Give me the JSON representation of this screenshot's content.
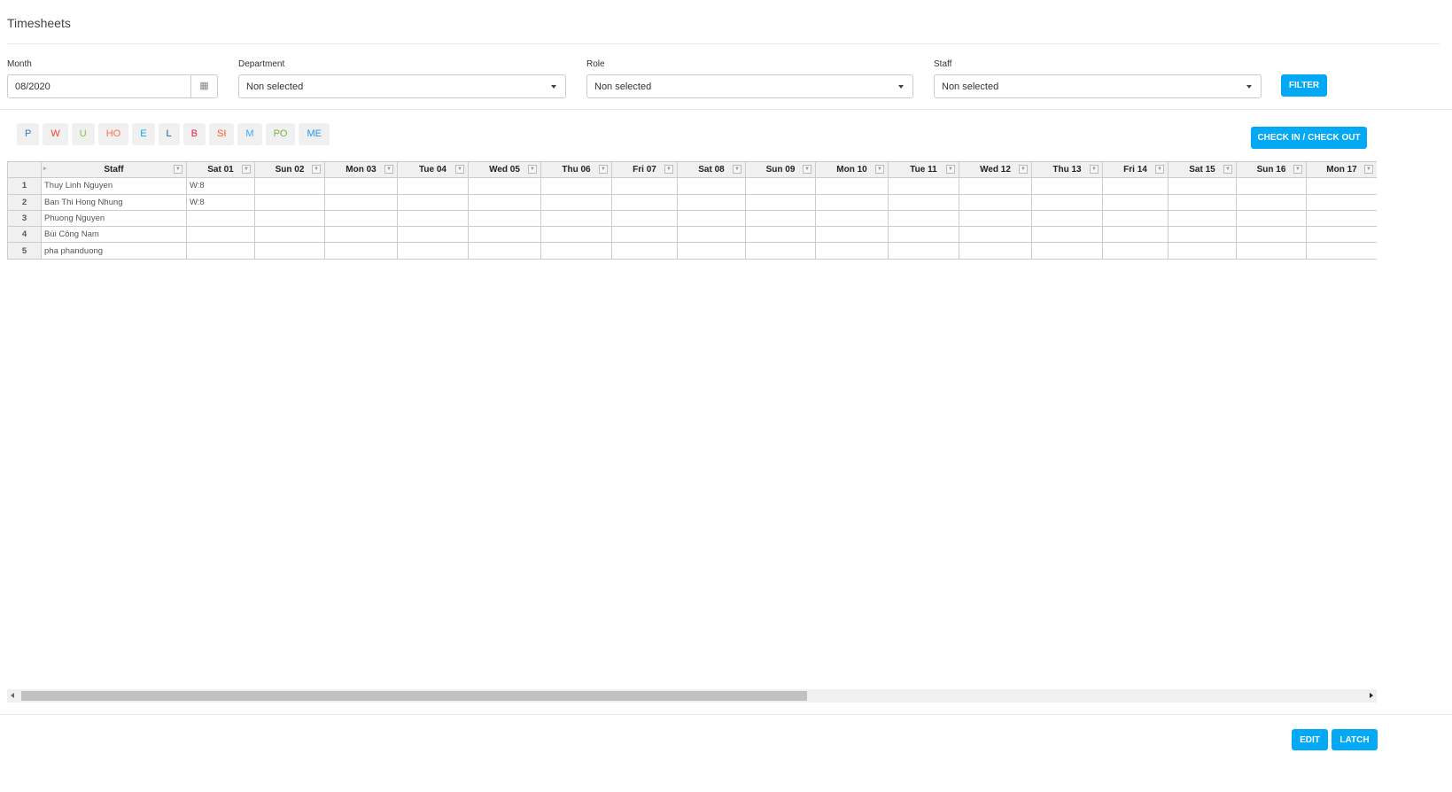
{
  "title": "Timesheets",
  "filters": {
    "month_label": "Month",
    "month_value": "08/2020",
    "department_label": "Department",
    "department_value": "Non selected",
    "role_label": "Role",
    "role_value": "Non selected",
    "staff_label": "Staff",
    "staff_value": "Non selected",
    "filter_button": "FILTER"
  },
  "legend": [
    {
      "code": "P",
      "color": "#337ab7"
    },
    {
      "code": "W",
      "color": "#f44336"
    },
    {
      "code": "U",
      "color": "#8bc34a"
    },
    {
      "code": "HO",
      "color": "#ff7043"
    },
    {
      "code": "E",
      "color": "#03a9f4"
    },
    {
      "code": "L",
      "color": "#1e5fa8"
    },
    {
      "code": "B",
      "color": "#e91e3c"
    },
    {
      "code": "SI",
      "color": "#ff5722"
    },
    {
      "code": "M",
      "color": "#42a5f5"
    },
    {
      "code": "PO",
      "color": "#7cb342"
    },
    {
      "code": "ME",
      "color": "#2196f3"
    }
  ],
  "check_button": "CHECK IN / CHECK OUT",
  "table": {
    "headers": [
      "Staff",
      "Sat 01",
      "Sun 02",
      "Mon 03",
      "Tue 04",
      "Wed 05",
      "Thu 06",
      "Fri 07",
      "Sat 08",
      "Sun 09",
      "Mon 10",
      "Tue 11",
      "Wed 12",
      "Thu 13",
      "Fri 14",
      "Sat 15",
      "Sun 16",
      "Mon 17"
    ],
    "rows": [
      {
        "num": "1",
        "staff": "Thuy Linh Nguyen",
        "days": [
          "W:8"
        ]
      },
      {
        "num": "2",
        "staff": "Ban Thi Hong Nhung",
        "days": [
          "W:8"
        ]
      },
      {
        "num": "3",
        "staff": "Phuong Nguyen",
        "days": []
      },
      {
        "num": "4",
        "staff": "Bùi Công Nam",
        "days": []
      },
      {
        "num": "5",
        "staff": "pha phanduong",
        "days": []
      }
    ]
  },
  "scroll_position_percent": 58,
  "footer": {
    "edit": "EDIT",
    "latch": "LATCH"
  },
  "accent": "#03a9f4"
}
